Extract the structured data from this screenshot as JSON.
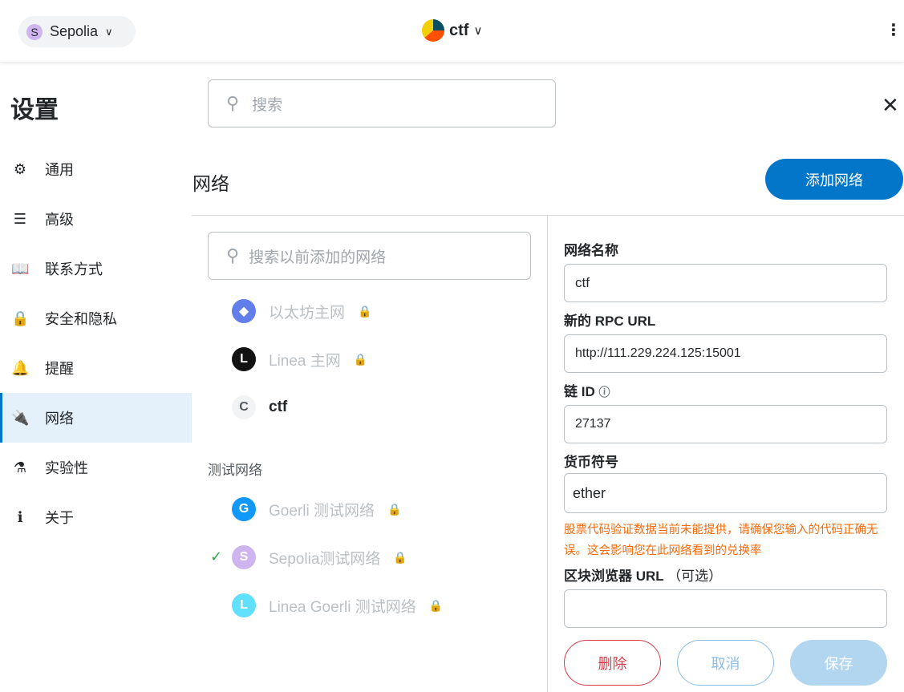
{
  "header": {
    "network": "Sepolia",
    "network_initial": "S",
    "account": "ctf"
  },
  "settings": {
    "title": "设置",
    "search_placeholder": "搜索"
  },
  "sidebar": {
    "items": [
      {
        "label": "通用",
        "icon": "gear-icon",
        "glyph": "⚙"
      },
      {
        "label": "高级",
        "icon": "sliders-icon",
        "glyph": "☰"
      },
      {
        "label": "联系方式",
        "icon": "book-icon",
        "glyph": "📖"
      },
      {
        "label": "安全和隐私",
        "icon": "lock-icon",
        "glyph": "🔒"
      },
      {
        "label": "提醒",
        "icon": "bell-icon",
        "glyph": "🔔"
      },
      {
        "label": "网络",
        "icon": "plug-icon",
        "glyph": "🔌"
      },
      {
        "label": "实验性",
        "icon": "flask-icon",
        "glyph": "⚗"
      },
      {
        "label": "关于",
        "icon": "info-icon",
        "glyph": "ℹ"
      }
    ]
  },
  "networks": {
    "title": "网络",
    "add_label": "添加网络",
    "search_placeholder": "搜索以前添加的网络",
    "test_label": "测试网络",
    "main": [
      {
        "name": "以太坊主网",
        "initial": "◆",
        "color": "#627eea",
        "locked": true
      },
      {
        "name": "Linea 主网",
        "initial": "L",
        "color": "#121212",
        "locked": true
      },
      {
        "name": "ctf",
        "initial": "C",
        "color": "#f2f3f4",
        "locked": false
      }
    ],
    "test": [
      {
        "name": "Goerli 测试网络",
        "initial": "G",
        "color": "#1098fc",
        "locked": true
      },
      {
        "name": "Sepolia测试网络",
        "initial": "S",
        "color": "#cfb5f0",
        "locked": true,
        "selected": true
      },
      {
        "name": "Linea Goerli 测试网络",
        "initial": "L",
        "color": "#61dfff",
        "locked": true
      }
    ]
  },
  "form": {
    "name_label": "网络名称",
    "name_value": "ctf",
    "rpc_label": "新的 RPC URL",
    "rpc_value": "http://111.229.224.125:15001",
    "chain_label": "链 ID",
    "chain_value": "27137",
    "symbol_label": "货币符号",
    "symbol_value": "ether",
    "warning": "股票代码验证数据当前未能提供，请确保您输入的代码正确无误。这会影响您在此网络看到的兑换率",
    "explorer_label": "区块浏览器 URL",
    "optional": "（可选）",
    "explorer_value": "",
    "delete": "删除",
    "cancel": "取消",
    "save": "保存"
  }
}
